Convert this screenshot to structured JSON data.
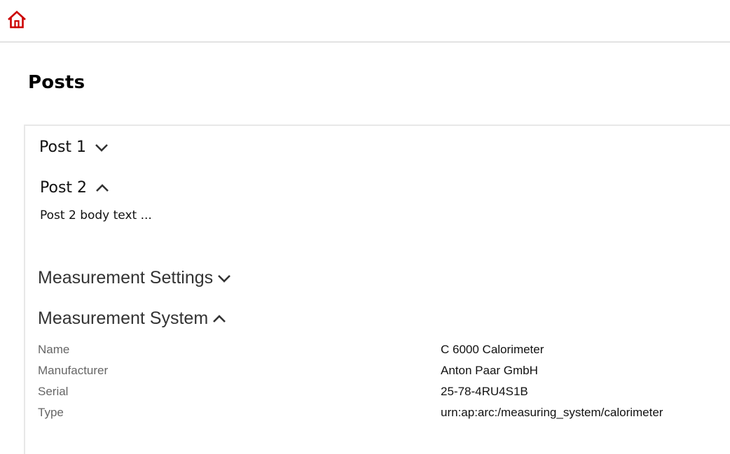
{
  "header": {
    "home_icon": "home-icon",
    "accent_color": "#cc0000"
  },
  "page": {
    "title": "Posts"
  },
  "posts": [
    {
      "title": "Post 1",
      "expanded": false,
      "chevron": "chevron-down-icon"
    },
    {
      "title": "Post 2",
      "expanded": true,
      "chevron": "chevron-up-icon",
      "body": "Post 2 body text ..."
    }
  ],
  "sections": [
    {
      "title": "Measurement Settings",
      "expanded": false,
      "chevron": "chevron-down-icon"
    },
    {
      "title": "Measurement System",
      "expanded": true,
      "chevron": "chevron-up-icon"
    }
  ],
  "measurement_system": {
    "properties": [
      {
        "label": "Name",
        "value": "C 6000 Calorimeter"
      },
      {
        "label": "Manufacturer",
        "value": "Anton Paar GmbH"
      },
      {
        "label": "Serial",
        "value": "25-78-4RU4S1B"
      },
      {
        "label": "Type",
        "value": "urn:ap:arc:/measuring_system/calorimeter"
      }
    ]
  }
}
